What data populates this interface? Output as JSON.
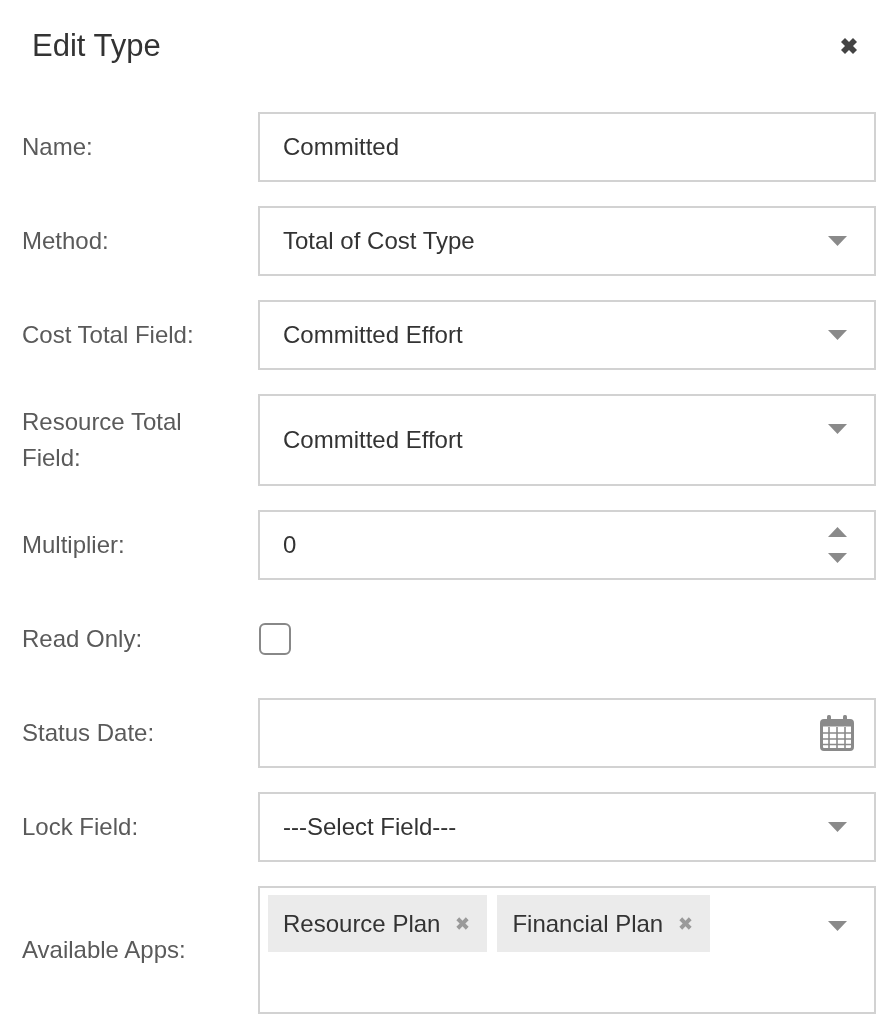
{
  "dialog": {
    "title": "Edit Type"
  },
  "fields": [
    {
      "kind": "text",
      "label": "Name:",
      "value": "Committed"
    },
    {
      "kind": "select",
      "label": "Method:",
      "value": "Total of Cost Type"
    },
    {
      "kind": "select",
      "label": "Cost Total Field:",
      "value": "Committed Effort"
    },
    {
      "kind": "select",
      "label": "Resource Total Field:",
      "value": "Committed Effort"
    },
    {
      "kind": "number",
      "label": "Multiplier:",
      "value": "0"
    },
    {
      "kind": "checkbox",
      "label": "Read Only:",
      "checked": false
    },
    {
      "kind": "date",
      "label": "Status Date:"
    },
    {
      "kind": "select",
      "label": "Lock Field:",
      "value": "---Select Field---"
    },
    {
      "kind": "multiselect",
      "label": "Available Apps:",
      "tags": [
        {
          "label": "Resource Plan"
        },
        {
          "label": "Financial Plan"
        }
      ]
    }
  ]
}
